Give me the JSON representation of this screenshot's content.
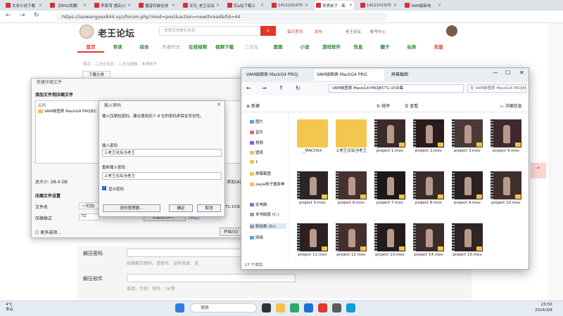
{
  "browser": {
    "tabs": [
      "文本小说下载",
      "【RPG/机翻",
      "李家湾 酒店(/)",
      "播音时装在线",
      "灰鸟_老王论坛",
      "实p站下载上",
      "1412101975",
      "发表帖子 - 新",
      "1412101975",
      "VAM最新电"
    ],
    "url": "https://laowangyex844.xyz/forum.php?mod=post&action=newthread&fid=44"
  },
  "forum": {
    "logo": "老王论坛",
    "search_placeholder": "搜索您想要的资源",
    "top_links": [
      "每日签到",
      "发布",
      "老王论坛",
      "帐号中心"
    ],
    "nav": [
      "首页",
      "导读",
      "综合",
      "灵者时光",
      "在线视频",
      "视频下载",
      "二次元",
      "套图",
      "小说",
      "游戏软件",
      "性息",
      "圈子",
      "站务",
      "充值"
    ],
    "breadcrumb": "首页 › 二次元专区 › 二次元视频 › 发表帖子",
    "forum_tab": "下载分类",
    "unzip_pwd_label": "解压密码",
    "unzip_pwd_hint": "如果解压密码，请填写，没有就填：无",
    "unzip_soft_label": "解压软件",
    "unzip_soft_hint": "选填。示例：快压、rar等"
  },
  "zip": {
    "title": "新建压缩文件",
    "section1": "添加文件到压缩文件",
    "col_name": "名称",
    "file": "VAM妹图表 MackG4 PROJEC...",
    "total": "总大小: 28.4 GB",
    "add": "添加(A)",
    "section2": "压缩文件设置",
    "l_filename": "文件名",
    "v_filename": "~(花园)",
    "v_filename_right": "T1-15合",
    "l_format": "压缩格式",
    "v_format": "7Z",
    "set_btn": "设置密码(P)...",
    "link": "[帮助]",
    "more": "更多选项...",
    "start": "开始(S)"
  },
  "pwd": {
    "title": "输入密码",
    "close": "✕",
    "desc": "输入压缩包密码。建议使用至少 8 位的密码来保证安全性。",
    "l1": "输入密码",
    "v1": "上老王论坛当老王",
    "l2": "重新输入密码",
    "v2": "上老王论坛当老王",
    "show": "显示密码",
    "btn_manage": "密码管理器...",
    "btn_ok": "确定",
    "btn_cancel": "取消"
  },
  "explorer": {
    "tabs": [
      "VAM妹图表 MackG4 PROJ",
      "VAM妹图表 MackG4 PRO.",
      "屏幕截图"
    ],
    "path": "VAM妹图表 MackG4 PROJECT1-15合集",
    "search": "在 VAM妹图表 MackG4 PROJECT",
    "toolbar": [
      "新建",
      "排序",
      "查看",
      "详细信息"
    ],
    "sidebar": [
      "图片",
      "音乐",
      "视频",
      "壁纸",
      "1",
      "屏幕截图",
      "sayw桃子酱原神",
      "此电脑",
      "本地磁盘 (C:)",
      "新加卷 (D:)",
      "网络"
    ],
    "items": [
      {
        "name": "_MACOSX",
        "kind": "folder"
      },
      {
        "name": "上老王论坛当老王",
        "kind": "folder"
      },
      {
        "name": "project 1.mov",
        "kind": "video"
      },
      {
        "name": "project 2.mov",
        "kind": "video"
      },
      {
        "name": "project 3.mov",
        "kind": "video"
      },
      {
        "name": "project 4.mov",
        "kind": "video"
      },
      {
        "name": "project 5.mov",
        "kind": "video"
      },
      {
        "name": "project 6.mov",
        "kind": "video"
      },
      {
        "name": "project 7.mov",
        "kind": "video"
      },
      {
        "name": "project 8.mov",
        "kind": "video"
      },
      {
        "name": "project 9.mov",
        "kind": "video"
      },
      {
        "name": "project 10.mov",
        "kind": "video"
      },
      {
        "name": "project 11.mov",
        "kind": "video"
      },
      {
        "name": "project 12.mov",
        "kind": "video"
      },
      {
        "name": "project 13.mov",
        "kind": "video"
      },
      {
        "name": "project 14.mov",
        "kind": "video"
      },
      {
        "name": "project 15.mov",
        "kind": "video"
      }
    ],
    "status": "17 个项目"
  },
  "taskbar": {
    "weather": "4°C\n多云",
    "search": "搜索",
    "time": "23:50",
    "date": "2024/3/8"
  }
}
